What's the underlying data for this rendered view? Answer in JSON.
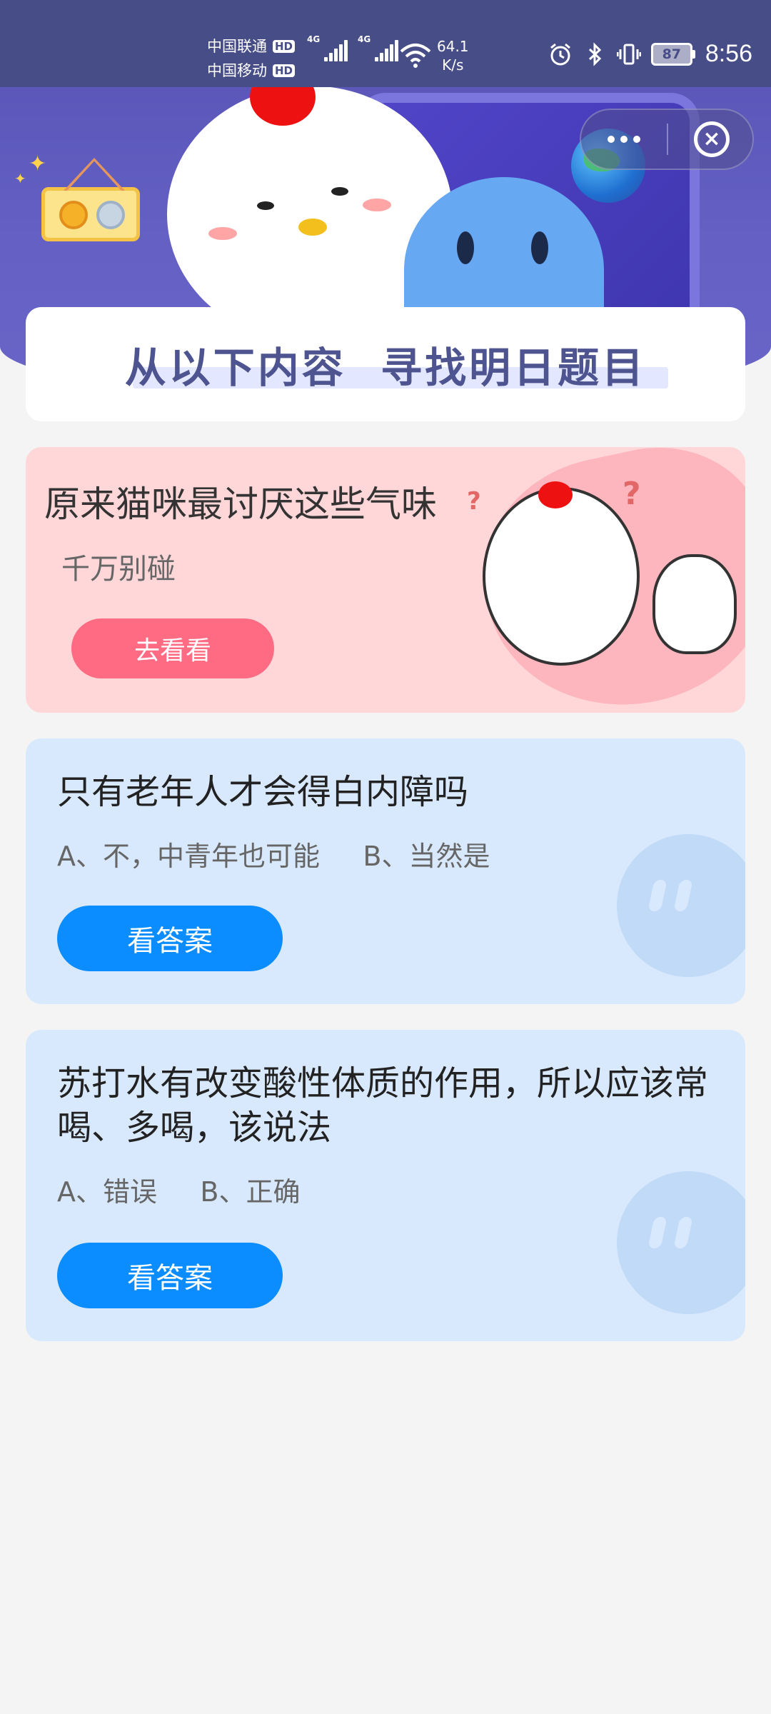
{
  "status_bar": {
    "carrier_1": "中国联通",
    "carrier_2": "中国移动",
    "hd_label": "HD",
    "network_type_1": "4G",
    "network_type_2": "4G",
    "net_speed_value": "64.1",
    "net_speed_unit": "K/s",
    "battery_level": "87",
    "time": "8:56",
    "icons": [
      "signal-icon",
      "wifi-icon",
      "alarm-icon",
      "bluetooth-icon",
      "vibrate-icon",
      "battery-icon"
    ]
  },
  "mini_program_capsule": {
    "more_icon": "more-dots-icon",
    "close_icon": "close-circle-icon"
  },
  "hero": {
    "banner_title": "从以下内容  寻找明日题目",
    "colors": {
      "background": "#5c58bd",
      "banner_text": "#4d5490"
    }
  },
  "article_card": {
    "title": "原来猫咪最讨厌这些气味",
    "subtitle": "千万别碰",
    "button_label": "去看看",
    "colors": {
      "background": "#ffd7d9",
      "button": "#ff6b82"
    }
  },
  "questions": [
    {
      "title": "只有老年人才会得白内障吗",
      "options": "A、不，中青年也可能     B、当然是",
      "button_label": "看答案"
    },
    {
      "title": "苏打水有改变酸性体质的作用，所以应该常喝、多喝，该说法",
      "options": "A、错误     B、正确",
      "button_label": "看答案"
    }
  ],
  "colors": {
    "question_card": "#d9e9fd",
    "answer_button": "#0b8dff",
    "page_background": "#f4f4f4"
  }
}
